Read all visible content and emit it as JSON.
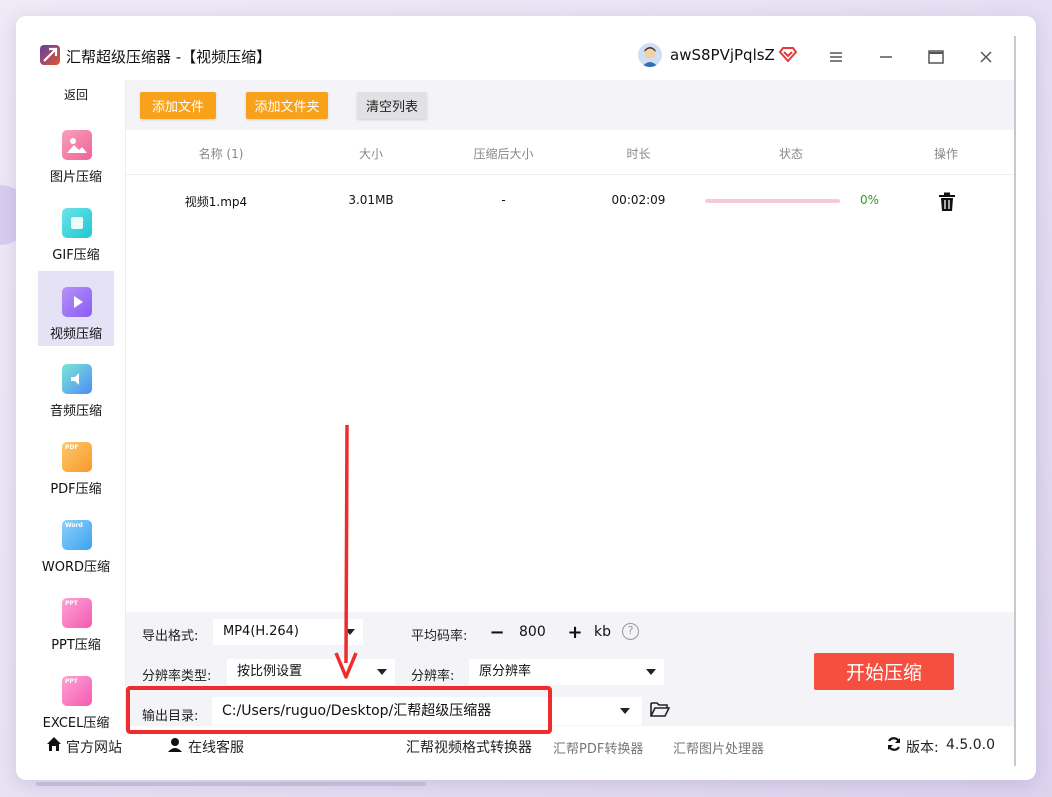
{
  "window": {
    "app_name": "汇帮超级压缩器",
    "title": "汇帮超级压缩器  -【视频压缩】",
    "username": "awS8PVjPqlsZ"
  },
  "sidebar": {
    "back_label": "返回",
    "items": [
      {
        "label": "图片压缩",
        "icon": "image-icon",
        "color": "#f0629c"
      },
      {
        "label": "GIF压缩",
        "icon": "gif-icon",
        "color": "#1ec8d2"
      },
      {
        "label": "视频压缩",
        "icon": "video-icon",
        "color": "#8b5cf6",
        "active": true
      },
      {
        "label": "音频压缩",
        "icon": "audio-icon",
        "color": "#4d8cf5"
      },
      {
        "label": "PDF压缩",
        "icon": "pdf-icon",
        "color": "#f79a2a",
        "tag": "PDF"
      },
      {
        "label": "WORD压缩",
        "icon": "word-icon",
        "color": "#3ba3f0",
        "tag": "Word"
      },
      {
        "label": "PPT压缩",
        "icon": "ppt-icon",
        "color": "#f65ab0",
        "tag": "PPT"
      },
      {
        "label": "EXCEL压缩",
        "icon": "excel-icon",
        "color": "#f65ab0",
        "tag": "PPT"
      }
    ]
  },
  "toolbar": {
    "add_file": "添加文件",
    "add_folder": "添加文件夹",
    "clear_list": "清空列表"
  },
  "table": {
    "headers": {
      "name": "名称 (1)",
      "size": "大小",
      "compressed_size": "压缩后大小",
      "duration": "时长",
      "status": "状态",
      "action": "操作"
    },
    "rows": [
      {
        "name": "视频1.mp4",
        "size": "3.01MB",
        "compressed_size": "-",
        "duration": "00:02:09",
        "progress": 0,
        "percent": "0%"
      }
    ]
  },
  "settings": {
    "format_label": "导出格式:",
    "format_value": "MP4(H.264)",
    "bitrate_label": "平均码率:",
    "bitrate_value": "800",
    "bitrate_unit": "kb",
    "res_type_label": "分辨率类型:",
    "res_type_value": "按比例设置",
    "res_label": "分辨率:",
    "res_value": "原分辨率",
    "output_label": "输出目录:",
    "output_path": "C:/Users/ruguo/Desktop/汇帮超级压缩器",
    "start_label": "开始压缩"
  },
  "footer": {
    "website": "官方网站",
    "support": "在线客服",
    "video_converter": "汇帮视频格式转换器",
    "pdf_converter": "汇帮PDF转换器",
    "image_processor": "汇帮图片处理器",
    "version_label": "版本:",
    "version": "4.5.0.0"
  },
  "colors": {
    "accent_orange": "#f7a21a",
    "start_red": "#f44f3f",
    "highlight_red": "#ee2c2c",
    "success_green": "#27a021"
  }
}
